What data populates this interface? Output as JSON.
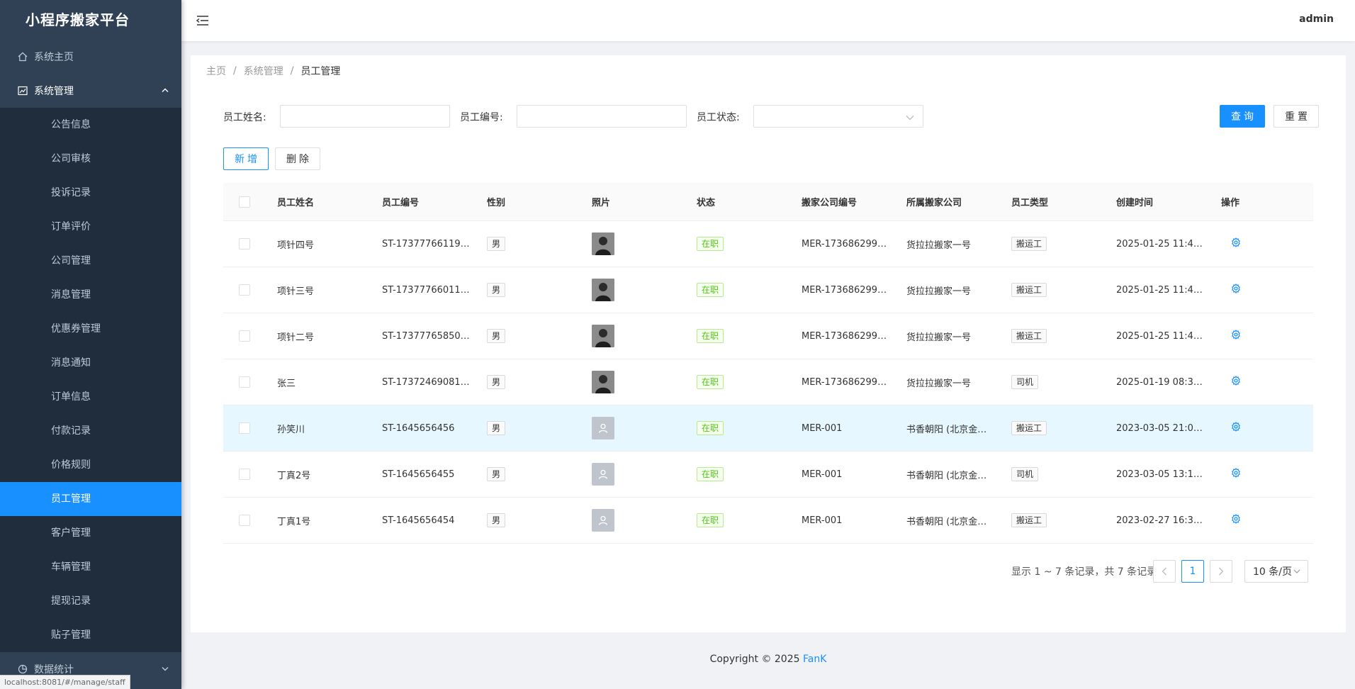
{
  "app": {
    "title": "小程序搬家平台",
    "user": "admin"
  },
  "sidebar": {
    "home": "系统主页",
    "system": "系统管理",
    "items": [
      {
        "label": "公告信息"
      },
      {
        "label": "公司审核"
      },
      {
        "label": "投诉记录"
      },
      {
        "label": "订单评价"
      },
      {
        "label": "公司管理"
      },
      {
        "label": "消息管理"
      },
      {
        "label": "优惠券管理"
      },
      {
        "label": "消息通知"
      },
      {
        "label": "订单信息"
      },
      {
        "label": "付款记录"
      },
      {
        "label": "价格规则"
      },
      {
        "label": "员工管理"
      },
      {
        "label": "客户管理"
      },
      {
        "label": "车辆管理"
      },
      {
        "label": "提现记录"
      },
      {
        "label": "贴子管理"
      }
    ],
    "stats": "数据统计",
    "status_url": "localhost:8081/#/manage/staff"
  },
  "breadcrumb": [
    "主页",
    "系统管理",
    "员工管理"
  ],
  "filters": {
    "name_label": "员工姓名:",
    "code_label": "员工编号:",
    "status_label": "员工状态:",
    "search_btn": "查询",
    "reset_btn": "重置"
  },
  "actions": {
    "add": "新增",
    "delete": "删除"
  },
  "table": {
    "headers": [
      "员工姓名",
      "员工编号",
      "性别",
      "照片",
      "状态",
      "搬家公司编号",
      "所属搬家公司",
      "员工类型",
      "创建时间",
      "操作"
    ],
    "rows": [
      {
        "name": "项针四号",
        "code": "ST-17377766119…",
        "gender": "男",
        "photo": "photo",
        "status": "在职",
        "company_code": "MER-173686299…",
        "company": "货拉拉搬家一号",
        "type": "搬运工",
        "created": "2025-01-25 11:4…"
      },
      {
        "name": "项针三号",
        "code": "ST-17377766011…",
        "gender": "男",
        "photo": "photo",
        "status": "在职",
        "company_code": "MER-173686299…",
        "company": "货拉拉搬家一号",
        "type": "搬运工",
        "created": "2025-01-25 11:4…"
      },
      {
        "name": "项针二号",
        "code": "ST-17377765850…",
        "gender": "男",
        "photo": "photo",
        "status": "在职",
        "company_code": "MER-173686299…",
        "company": "货拉拉搬家一号",
        "type": "搬运工",
        "created": "2025-01-25 11:4…"
      },
      {
        "name": "张三",
        "code": "ST-17372469081…",
        "gender": "男",
        "photo": "photo",
        "status": "在职",
        "company_code": "MER-173686299…",
        "company": "货拉拉搬家一号",
        "type": "司机",
        "created": "2025-01-19 08:3…"
      },
      {
        "name": "孙笑川",
        "code": "ST-1645656456",
        "gender": "男",
        "photo": "placeholder",
        "status": "在职",
        "company_code": "MER-001",
        "company": "书香朝阳 (北京金…",
        "type": "搬运工",
        "created": "2023-03-05 21:0…"
      },
      {
        "name": "丁真2号",
        "code": "ST-1645656455",
        "gender": "男",
        "photo": "placeholder",
        "status": "在职",
        "company_code": "MER-001",
        "company": "书香朝阳 (北京金…",
        "type": "司机",
        "created": "2023-03-05 13:1…"
      },
      {
        "name": "丁真1号",
        "code": "ST-1645656454",
        "gender": "男",
        "photo": "placeholder",
        "status": "在职",
        "company_code": "MER-001",
        "company": "书香朝阳 (北京金…",
        "type": "搬运工",
        "created": "2023-02-27 16:3…"
      }
    ]
  },
  "pagination": {
    "summary": "显示 1 ~ 7 条记录，共 7 条记录",
    "current": "1",
    "page_size": "10 条/页"
  },
  "footer": {
    "text": "Copyright © 2025 ",
    "brand": "FanK"
  },
  "colors": {
    "sidebar_bg": "#304156",
    "submenu_bg": "#1f2d3d",
    "accent": "#1890ff",
    "status_green": "#52c41a"
  }
}
